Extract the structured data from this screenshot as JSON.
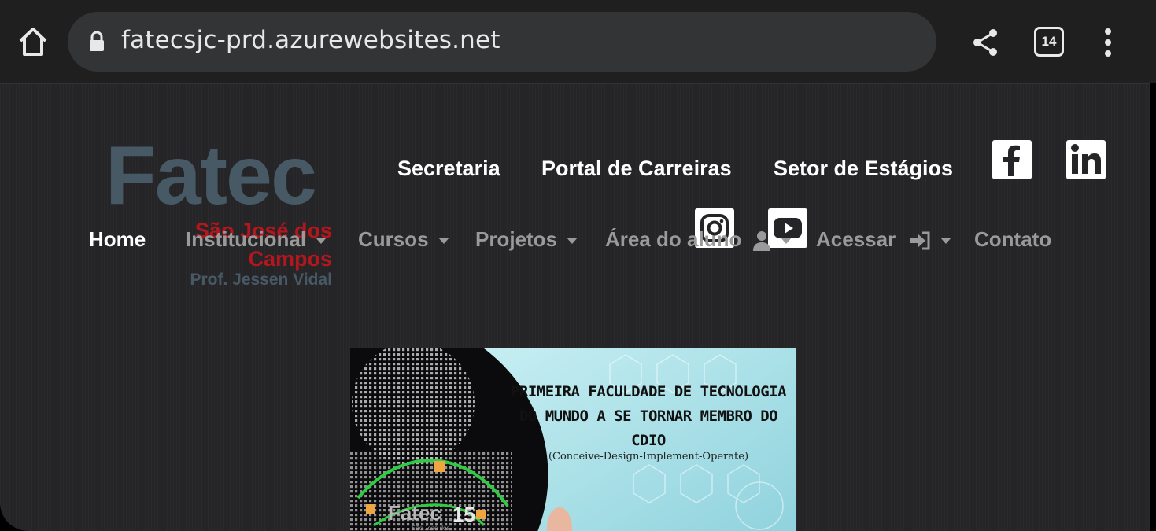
{
  "browser": {
    "url": "fatecsjc-prd.azurewebsites.net",
    "tab_count": "14"
  },
  "logo": {
    "name": "Fatec",
    "city": "São José dos Campos",
    "city_line1": "São José dos",
    "city_line2": "Campos",
    "prof": "Prof. Jessen Vidal"
  },
  "top_links": {
    "secretaria": "Secretaria",
    "carreiras": "Portal de Carreiras",
    "estagios": "Setor de Estágios"
  },
  "social": [
    "facebook-icon",
    "linkedin-icon",
    "instagram-icon",
    "youtube-icon"
  ],
  "nav": {
    "home": "Home",
    "institucional": "Institucional",
    "cursos": "Cursos",
    "projetos": "Projetos",
    "area_aluno": "Área do aluno",
    "acessar": "Acessar",
    "contato": "Contato"
  },
  "banner": {
    "title_line1": "PRIMEIRA FACULDADE DE TECNOLOGIA",
    "title_line2": "DO MUNDO A SE TORNAR MEMBRO DO",
    "title_line3": "CDIO",
    "subtitle": "(Conceive-Design-Implement-Operate)",
    "logo_text": "Fatec",
    "logo_number": "15",
    "logo_city": "São José dos"
  },
  "colors": {
    "page_bg": "#252528",
    "logo_gray": "#475965",
    "logo_red": "#b3161c",
    "nav_gray": "#9a9a9a"
  }
}
